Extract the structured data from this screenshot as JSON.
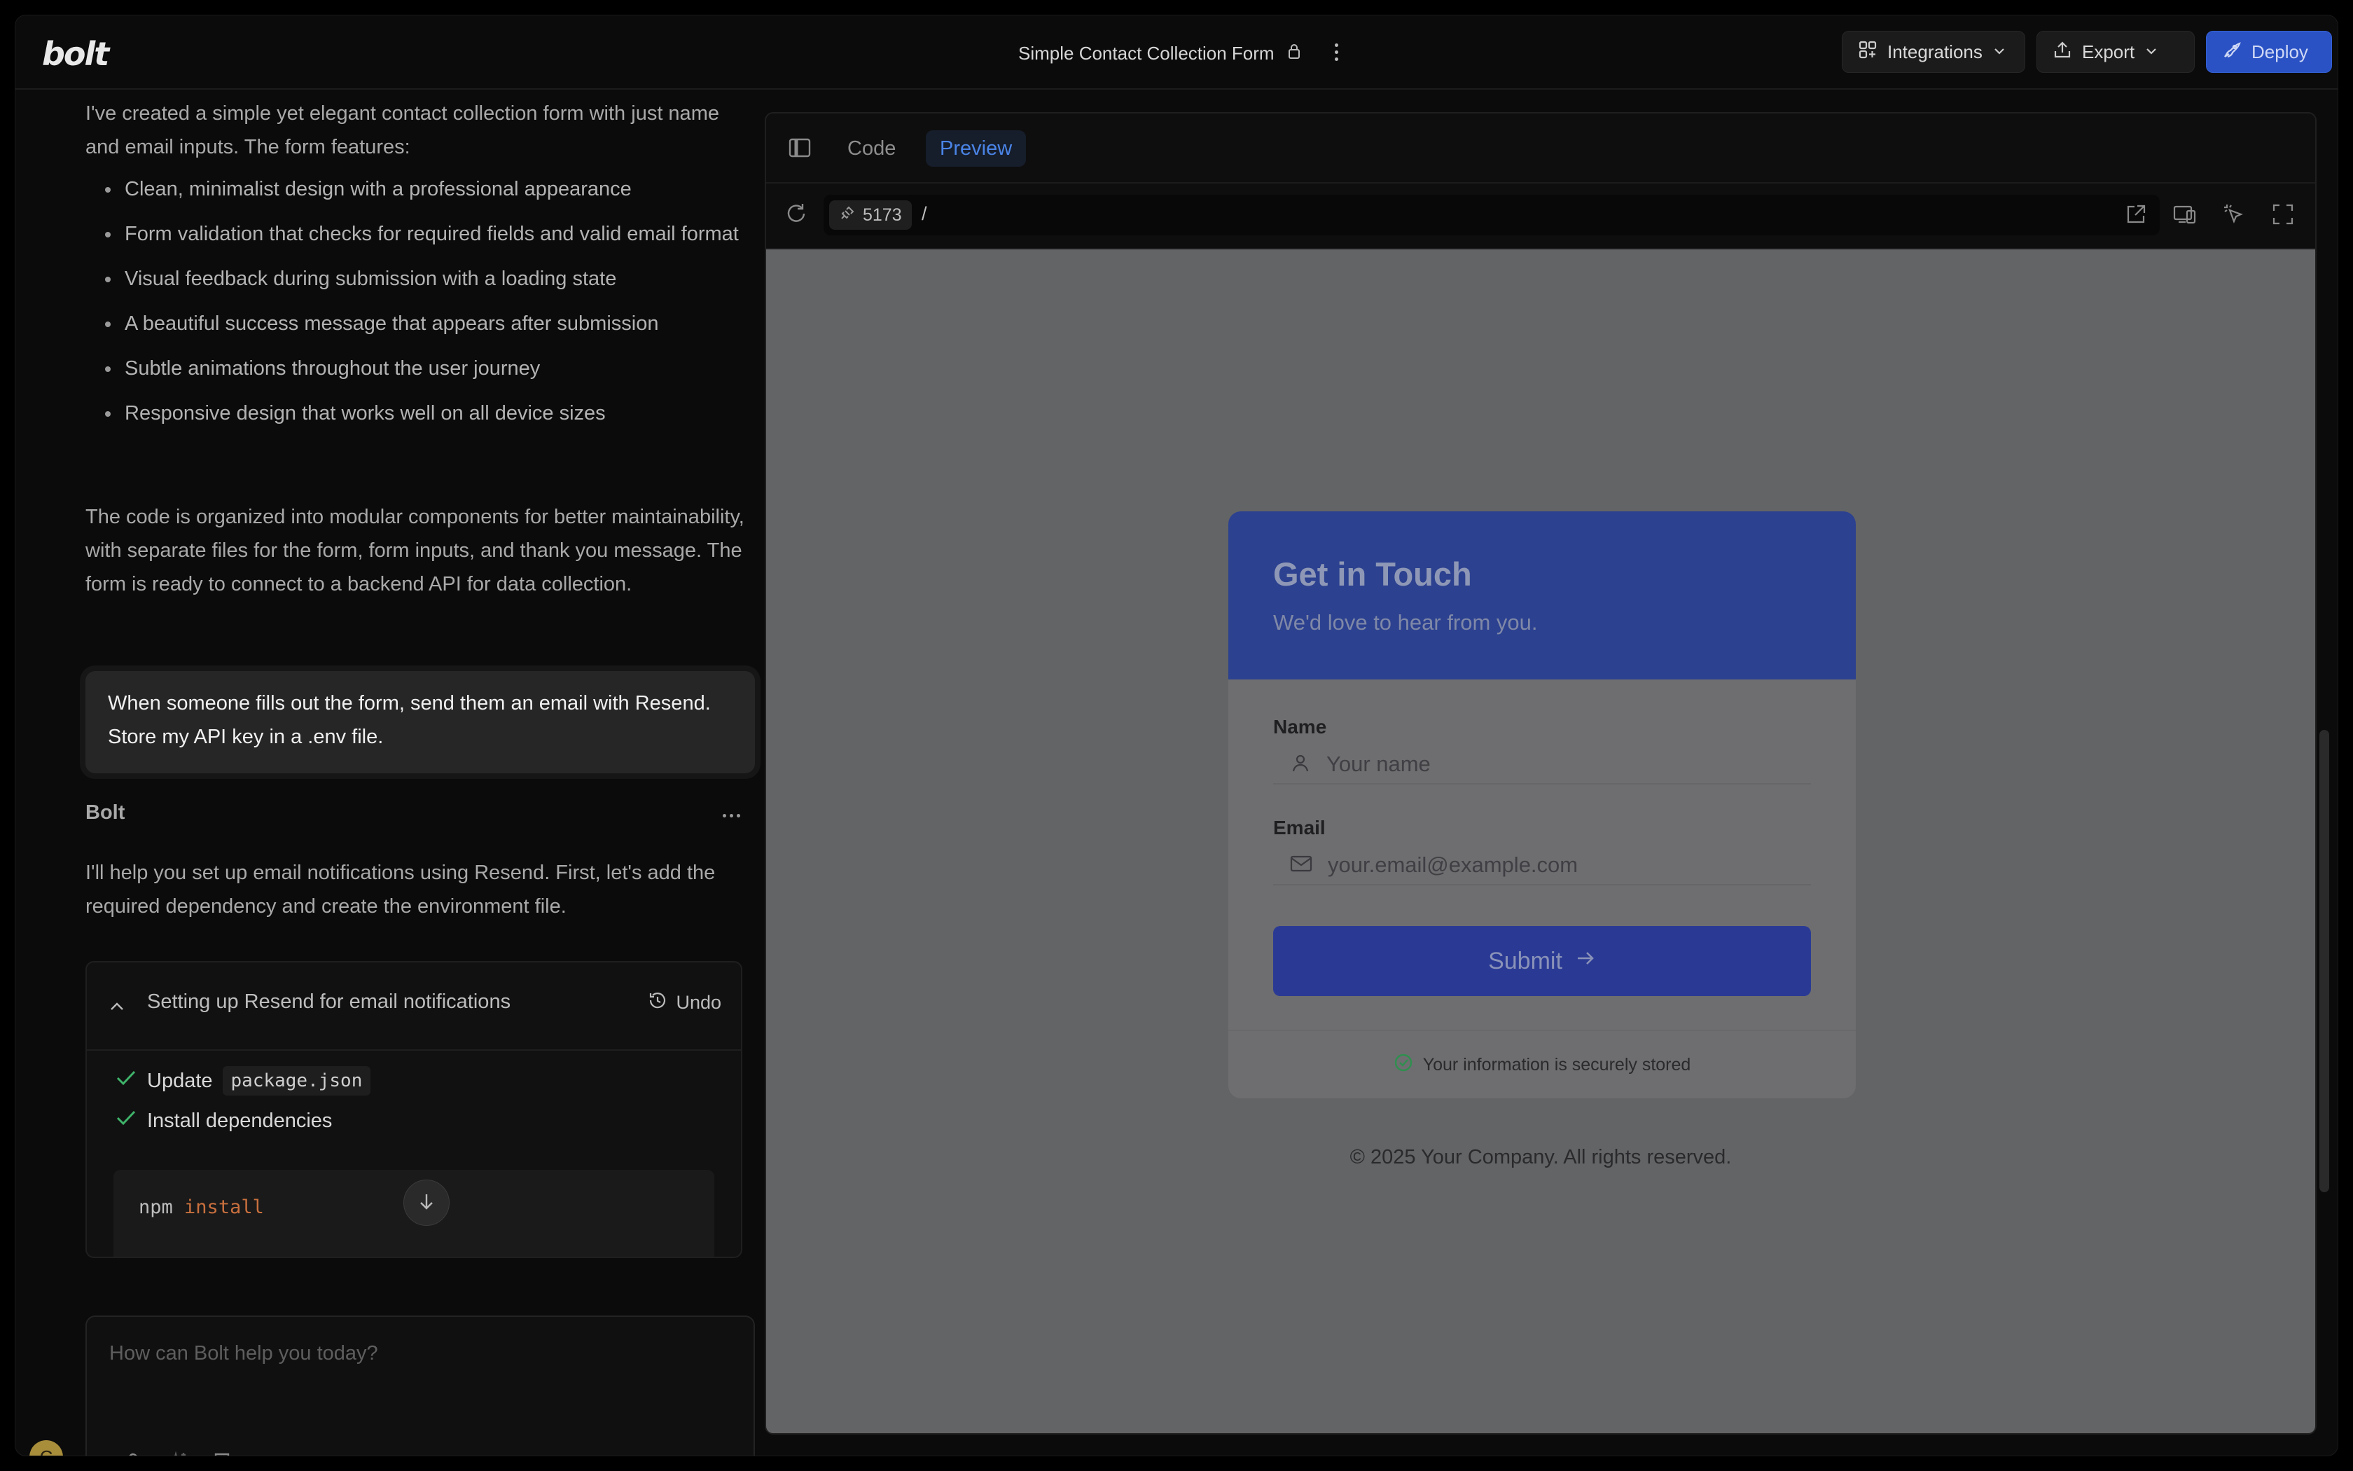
{
  "header": {
    "logo": "bolt",
    "project_title": "Simple Contact Collection Form",
    "integrations_label": "Integrations",
    "export_label": "Export",
    "deploy_label": "Deploy"
  },
  "chat": {
    "intro_text": "I've created a simple yet elegant contact collection form with just name and email inputs. The form features:",
    "features": [
      "Clean, minimalist design with a professional appearance",
      "Form validation that checks for required fields and valid email format",
      "Visual feedback during submission with a loading state",
      "A beautiful success message that appears after submission",
      "Subtle animations throughout the user journey",
      "Responsive design that works well on all device sizes"
    ],
    "summary_text": "The code is organized into modular components for better maintainability, with separate files for the form, form inputs, and thank you message. The form is ready to connect to a backend API for data collection.",
    "user_message": "When someone fills out the form, send them an email with Resend. Store my API key in a .env file.",
    "assistant_name": "Bolt",
    "assistant_reply": "I'll help you set up email notifications using Resend. First, let's add the required dependency and create the environment file.",
    "action": {
      "title": "Setting up Resend for email notifications",
      "undo_label": "Undo",
      "step1_label": "Update",
      "step1_file": "package.json",
      "step2_label": "Install dependencies",
      "terminal_cmd": "npm",
      "terminal_arg": "install"
    },
    "prompt_placeholder": "How can Bolt help you today?",
    "avatar_initial": "C"
  },
  "preview": {
    "tab_code": "Code",
    "tab_preview": "Preview",
    "port": "5173",
    "path": "/",
    "form": {
      "title": "Get in Touch",
      "subtitle": "We'd love to hear from you.",
      "name_label": "Name",
      "name_placeholder": "Your name",
      "email_label": "Email",
      "email_placeholder": "your.email@example.com",
      "submit_label": "Submit",
      "secure_note": "Your information is securely stored"
    },
    "copyright": "© 2025 Your Company. All rights reserved."
  },
  "colors": {
    "accent": "#2a52c4",
    "preview_tab": "#4a84e6",
    "check": "#3fb36a",
    "card_header": "#2c418f",
    "submit_bg": "#2a3a94"
  }
}
